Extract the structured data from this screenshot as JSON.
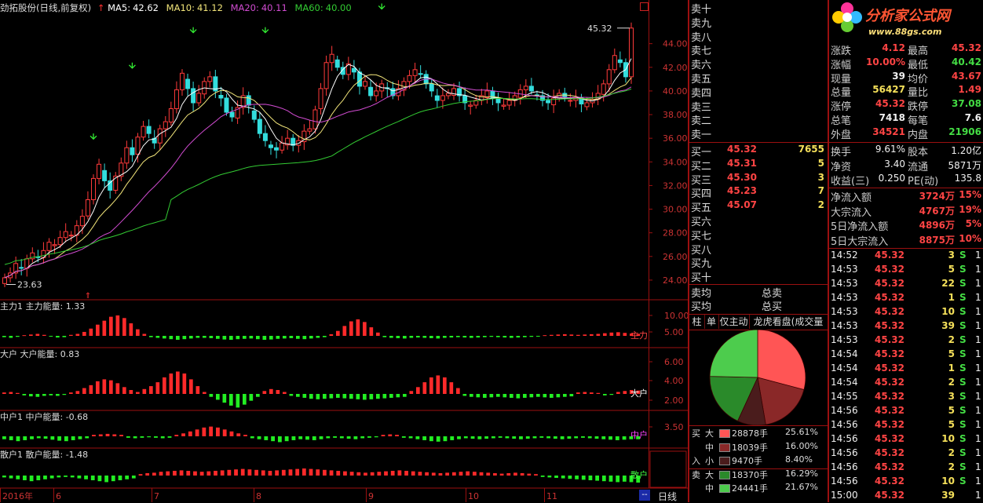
{
  "chart_header": {
    "stock_name": "劲拓股份(日线,前复权)",
    "ma5_label": "MA5:",
    "ma5": "42.62",
    "ma10_label": "MA10:",
    "ma10": "41.12",
    "ma20_label": "MA20:",
    "ma20": "40.11",
    "ma60_label": "MA60:",
    "ma60": "40.00"
  },
  "colors": {
    "up": "#ff3a3a",
    "down": "#33dddd",
    "ma5": "#ffffff",
    "ma10": "#f2e57a",
    "ma20": "#d24cd2",
    "ma60": "#33cc33",
    "frame": "#9b1010",
    "bar_up": "#ff2a2a",
    "bar_down": "#22ee22"
  },
  "chart_data": [
    {
      "type": "candlestick",
      "title": "劲拓股份(日线,前复权)",
      "y_ticks": [
        "44.00",
        "42.00",
        "40.00",
        "38.00",
        "36.00",
        "34.00",
        "32.00",
        "30.00",
        "28.00",
        "26.00",
        "24.00"
      ],
      "ylim": [
        23.0,
        46.5
      ],
      "annotations": {
        "high": "45.32",
        "low": "23.63"
      },
      "x_ticks": [
        "2016年",
        "6",
        "7",
        "8",
        "9",
        "10",
        "11"
      ],
      "series": [
        {
          "name": "MA5",
          "value": "42.62"
        },
        {
          "name": "MA10",
          "value": "41.12"
        },
        {
          "name": "MA20",
          "value": "40.11"
        },
        {
          "name": "MA60",
          "value": "40.00"
        }
      ],
      "close": [
        24.2,
        24.6,
        25.4,
        25.0,
        25.8,
        26.3,
        25.9,
        26.5,
        27.2,
        27.0,
        27.6,
        28.1,
        27.8,
        28.6,
        29.4,
        30.8,
        32.6,
        33.8,
        32.4,
        31.6,
        32.8,
        33.9,
        35.2,
        34.6,
        36.1,
        37.0,
        36.4,
        35.6,
        36.8,
        37.4,
        38.5,
        40.1,
        41.5,
        40.2,
        39.0,
        39.8,
        40.8,
        41.2,
        40.0,
        39.4,
        38.2,
        37.8,
        38.6,
        39.6,
        38.8,
        37.6,
        36.4,
        35.8,
        35.2,
        35.0,
        35.6,
        36.0,
        35.4,
        35.8,
        36.6,
        36.8,
        38.4,
        40.2,
        42.4,
        43.1,
        42.0,
        41.4,
        42.3,
        41.6,
        40.4,
        40.8,
        39.6,
        40.0,
        40.6,
        40.2,
        39.6,
        40.2,
        40.8,
        41.3,
        41.8,
        41.4,
        40.6,
        40.0,
        39.2,
        39.6,
        39.8,
        40.2,
        39.6,
        39.0,
        38.8,
        39.2,
        39.6,
        40.0,
        39.4,
        39.0,
        38.8,
        39.2,
        39.6,
        40.1,
        40.4,
        40.0,
        39.6,
        39.2,
        39.0,
        39.4,
        39.8,
        39.5,
        39.2,
        39.4,
        38.9,
        39.0,
        39.3,
        39.8,
        40.6,
        41.8,
        43.0,
        42.4,
        41.2,
        45.32
      ]
    },
    {
      "type": "bar",
      "title": "主力1",
      "label": "主力能量",
      "value": "1.33",
      "y_ticks": [
        "10.00",
        "5.00"
      ],
      "tag": "主力",
      "values": [
        -0.4,
        -0.6,
        -0.3,
        0.2,
        0.4,
        0.6,
        0.3,
        -0.2,
        -0.5,
        -0.4,
        0.3,
        0.6,
        1.2,
        2.2,
        3.4,
        4.6,
        5.8,
        6.2,
        5.4,
        3.8,
        2.0,
        0.6,
        -0.4,
        -0.6,
        -0.8,
        -1.0,
        -1.2,
        -1.0,
        -0.8,
        -0.6,
        -0.6,
        -0.7,
        -0.9,
        -1.1,
        -1.2,
        -1.0,
        -0.9,
        -0.8,
        -1.0,
        -1.2,
        -1.1,
        -0.9,
        -0.8,
        -0.7,
        -0.9,
        -1.0,
        -0.8,
        -0.6,
        -0.4,
        0.5,
        1.5,
        3.0,
        4.4,
        5.0,
        4.2,
        2.6,
        1.0,
        -0.4,
        -0.6,
        -0.7,
        -0.8,
        -0.6,
        -0.5,
        -0.6,
        -0.7,
        -0.8,
        -0.6,
        -0.5,
        -0.4,
        -0.5,
        -0.6,
        -0.5,
        -0.4,
        -0.3,
        -0.4,
        -0.5,
        -0.6,
        -0.5,
        -0.4,
        -0.3,
        -0.2,
        0.2,
        0.3,
        0.4,
        0.5,
        0.4,
        0.3,
        0.4,
        0.5,
        0.6,
        0.8,
        1.0,
        1.1,
        0.9,
        0.7,
        0.6
      ]
    },
    {
      "type": "bar",
      "title": "大户",
      "label": "大户能量",
      "value": "0.83",
      "y_ticks": [
        "6.00",
        "4.00",
        "2.00"
      ],
      "tag": "大户",
      "values": [
        0.3,
        0.4,
        0.2,
        -0.3,
        -0.5,
        -0.6,
        -0.4,
        -0.3,
        -0.4,
        -0.2,
        0.3,
        0.6,
        1.2,
        1.8,
        2.6,
        3.0,
        2.8,
        2.2,
        1.4,
        0.8,
        0.4,
        1.0,
        1.6,
        2.4,
        3.4,
        4.2,
        4.6,
        4.2,
        3.0,
        1.6,
        0.4,
        -0.6,
        -1.2,
        -1.8,
        -2.4,
        -2.8,
        -2.2,
        -1.4,
        -0.6,
        0.6,
        1.0,
        0.8,
        0.4,
        -0.4,
        -0.6,
        -0.8,
        -1.0,
        -1.1,
        -1.0,
        -0.9,
        -0.8,
        -0.9,
        -1.0,
        -1.1,
        -1.2,
        -1.1,
        -1.0,
        -0.9,
        -0.8,
        -0.7,
        -0.6,
        0.6,
        1.4,
        2.4,
        3.4,
        3.8,
        3.4,
        2.4,
        1.2,
        -0.4,
        -0.6,
        -0.7,
        -0.8,
        -0.7,
        -0.6,
        -0.7,
        -0.8,
        -0.9,
        -0.8,
        -0.7,
        -0.6,
        -0.7,
        -0.8,
        -0.7,
        -0.6,
        -0.5,
        0.3,
        0.4,
        0.3,
        0.2,
        -0.3,
        -0.2,
        0.4,
        0.6,
        0.8,
        0.7
      ]
    },
    {
      "type": "bar",
      "title": "中户1",
      "label": "中户能量",
      "value": "-0.68",
      "y_ticks": [
        "3.50"
      ],
      "tag": "中户",
      "values": [
        -0.6,
        -0.8,
        -1.0,
        -0.8,
        -0.6,
        -0.4,
        -0.5,
        -0.7,
        -0.9,
        -1.0,
        -0.8,
        -0.6,
        -0.4,
        0.3,
        0.4,
        0.5,
        0.4,
        0.3,
        -0.3,
        -0.4,
        -0.3,
        -0.2,
        -0.3,
        -0.4,
        -0.3,
        0.3,
        0.6,
        1.0,
        1.4,
        1.8,
        2.0,
        1.8,
        1.4,
        1.0,
        0.6,
        0.3,
        -0.4,
        -0.6,
        -0.8,
        -1.0,
        -1.2,
        -1.0,
        -0.8,
        -0.6,
        -0.7,
        -0.8,
        -0.6,
        -0.4,
        -0.3,
        -0.4,
        -0.5,
        -0.6,
        -0.4,
        -0.3,
        -0.2,
        0.3,
        0.4,
        0.3,
        -0.3,
        -0.4,
        -0.6,
        -0.8,
        -1.0,
        -1.1,
        -1.0,
        -0.8,
        -0.6,
        -0.4,
        -0.5,
        -0.6,
        -0.5,
        -0.4,
        -0.3,
        -0.4,
        -0.5,
        -0.6,
        -0.5,
        -0.4,
        -0.3,
        -0.4,
        -0.5,
        -0.6,
        -0.5,
        -0.4,
        -0.3,
        -0.4,
        -0.5,
        -0.6,
        -0.7,
        -0.8,
        -0.7,
        -0.6,
        -0.6
      ]
    },
    {
      "type": "bar",
      "title": "散户1",
      "label": "散户能量",
      "value": "-1.48",
      "y_ticks": [],
      "tag": "散户",
      "values": [
        -0.4,
        -0.6,
        -0.8,
        -1.0,
        -1.2,
        -1.0,
        -0.8,
        -0.6,
        -0.4,
        -0.3,
        -0.4,
        -0.6,
        -0.8,
        -1.0,
        -1.2,
        -1.4,
        -1.2,
        -1.0,
        -0.8,
        -0.6,
        0.3,
        0.5,
        0.6,
        0.8,
        0.9,
        1.0,
        1.1,
        1.0,
        0.9,
        0.8,
        0.9,
        1.0,
        1.1,
        1.2,
        1.3,
        1.4,
        1.3,
        1.2,
        1.1,
        1.0,
        1.1,
        1.2,
        1.3,
        1.4,
        1.5,
        1.4,
        1.3,
        1.2,
        1.1,
        1.0,
        0.9,
        0.8,
        0.7,
        0.6,
        0.7,
        0.8,
        0.9,
        1.0,
        1.1,
        1.0,
        0.9,
        0.8,
        0.7,
        0.6,
        0.5,
        0.6,
        0.7,
        0.8,
        0.9,
        0.8,
        0.7,
        0.6,
        0.5,
        0.4,
        0.5,
        0.6,
        0.5,
        0.4,
        0.3,
        -0.3,
        -0.4,
        -0.5,
        -0.6,
        -0.7,
        -0.8,
        -0.9,
        -1.0,
        -1.1,
        -1.2,
        -1.3,
        -1.4,
        -1.3,
        -1.4,
        -1.5
      ]
    },
    {
      "type": "pie",
      "title": "龙虎看盘",
      "categories": [
        "买大",
        "买中",
        "买小",
        "卖大",
        "卖中"
      ],
      "values": [
        25.61,
        16.0,
        8.4,
        16.29,
        21.67
      ],
      "colors": [
        "#ff5555",
        "#8a2828",
        "#4a1c1c",
        "#2a8a2a",
        "#4dcc4d"
      ]
    }
  ],
  "sell_orders": [
    "卖十",
    "卖九",
    "卖八",
    "卖七",
    "卖六",
    "卖五",
    "卖四",
    "卖三",
    "卖二",
    "卖一"
  ],
  "buy_orders": [
    {
      "label": "买一",
      "price": "45.32",
      "vol": "7655"
    },
    {
      "label": "买二",
      "price": "45.31",
      "vol": "5"
    },
    {
      "label": "买三",
      "price": "45.30",
      "vol": "3"
    },
    {
      "label": "买四",
      "price": "45.23",
      "vol": "7"
    },
    {
      "label": "买五",
      "price": "45.07",
      "vol": "2"
    },
    {
      "label": "买六",
      "price": "",
      "vol": ""
    },
    {
      "label": "买七",
      "price": "",
      "vol": ""
    },
    {
      "label": "买八",
      "price": "",
      "vol": ""
    },
    {
      "label": "买九",
      "price": "",
      "vol": ""
    },
    {
      "label": "买十",
      "price": "",
      "vol": ""
    }
  ],
  "avg": {
    "sell_avg": "卖均",
    "sell_total": "总卖",
    "buy_avg": "买均",
    "buy_total": "总买"
  },
  "tabs": [
    "柱",
    "单",
    "仅主动",
    "龙虎看盘(成交量板"
  ],
  "legend": [
    {
      "side": "买",
      "size": "大",
      "amount": "28878手",
      "pct": "25.61%",
      "color": "#ff5555"
    },
    {
      "side": "",
      "size": "中",
      "amount": "18039手",
      "pct": "16.00%",
      "color": "#8a2828"
    },
    {
      "side": "入",
      "size": "小",
      "amount": "9470手",
      "pct": "8.40%",
      "color": "#4a1c1c"
    },
    {
      "side": "卖",
      "size": "大",
      "amount": "18370手",
      "pct": "16.29%",
      "color": "#2a8a2a"
    },
    {
      "side": "",
      "size": "中",
      "amount": "24441手",
      "pct": "21.67%",
      "color": "#4dcc4d"
    }
  ],
  "brand": {
    "title": "分析家公式网",
    "url": "www.88gs.com"
  },
  "quote": {
    "rows": [
      {
        "l1": "涨跌",
        "v1": "4.12",
        "c1": "red",
        "l2": "最高",
        "v2": "45.32",
        "c2": "red"
      },
      {
        "l1": "涨幅",
        "v1": "10.00%",
        "c1": "red",
        "l2": "最低",
        "v2": "40.42",
        "c2": "grn"
      },
      {
        "l1": "现量",
        "v1": "39",
        "c1": "wht",
        "l2": "均价",
        "v2": "43.67",
        "c2": "red"
      },
      {
        "l1": "总量",
        "v1": "56427",
        "c1": "yel",
        "l2": "量比",
        "v2": "1.49",
        "c2": "red"
      },
      {
        "l1": "涨停",
        "v1": "45.32",
        "c1": "red",
        "l2": "跌停",
        "v2": "37.08",
        "c2": "grn"
      },
      {
        "l1": "总笔",
        "v1": "7418",
        "c1": "wht",
        "l2": "每笔",
        "v2": "7.6",
        "c2": "wht"
      },
      {
        "l1": "外盘",
        "v1": "34521",
        "c1": "red",
        "l2": "内盘",
        "v2": "21906",
        "c2": "grn"
      }
    ],
    "rows2": [
      {
        "l1": "换手",
        "v1": "9.61%",
        "l2": "股本",
        "v2": "1.20亿"
      },
      {
        "l1": "净资",
        "v1": "3.40",
        "l2": "流通",
        "v2": "5871万"
      },
      {
        "l1": "收益(三)",
        "v1": "0.250",
        "l2": "PE(动)",
        "v2": "135.8"
      }
    ],
    "flows": [
      {
        "label": "净流入额",
        "amount": "3724万",
        "pct": "15%"
      },
      {
        "label": "大宗流入",
        "amount": "4767万",
        "pct": "19%"
      },
      {
        "label": "5日净流入额",
        "amount": "4896万",
        "pct": "5%"
      },
      {
        "label": "5日大宗流入",
        "amount": "8875万",
        "pct": "10%"
      }
    ]
  },
  "ticks": [
    {
      "t": "14:52",
      "p": "45.32",
      "v": "3",
      "s": "S",
      "n": "1"
    },
    {
      "t": "14:53",
      "p": "45.32",
      "v": "5",
      "s": "S",
      "n": "1"
    },
    {
      "t": "14:53",
      "p": "45.32",
      "v": "22",
      "s": "S",
      "n": "1"
    },
    {
      "t": "14:53",
      "p": "45.32",
      "v": "1",
      "s": "S",
      "n": "1"
    },
    {
      "t": "14:53",
      "p": "45.32",
      "v": "10",
      "s": "S",
      "n": "1"
    },
    {
      "t": "14:53",
      "p": "45.32",
      "v": "39",
      "s": "S",
      "n": "1"
    },
    {
      "t": "14:53",
      "p": "45.32",
      "v": "2",
      "s": "S",
      "n": "1"
    },
    {
      "t": "14:54",
      "p": "45.32",
      "v": "5",
      "s": "S",
      "n": "1"
    },
    {
      "t": "14:54",
      "p": "45.32",
      "v": "1",
      "s": "S",
      "n": "1"
    },
    {
      "t": "14:54",
      "p": "45.32",
      "v": "2",
      "s": "S",
      "n": "1"
    },
    {
      "t": "14:55",
      "p": "45.32",
      "v": "3",
      "s": "S",
      "n": "1"
    },
    {
      "t": "14:56",
      "p": "45.32",
      "v": "5",
      "s": "S",
      "n": "1"
    },
    {
      "t": "14:56",
      "p": "45.32",
      "v": "5",
      "s": "S",
      "n": "1"
    },
    {
      "t": "14:56",
      "p": "45.32",
      "v": "10",
      "s": "S",
      "n": "1"
    },
    {
      "t": "14:56",
      "p": "45.32",
      "v": "2",
      "s": "S",
      "n": "1"
    },
    {
      "t": "14:56",
      "p": "45.32",
      "v": "2",
      "s": "S",
      "n": "1"
    },
    {
      "t": "14:56",
      "p": "45.32",
      "v": "10",
      "s": "S",
      "n": "1"
    },
    {
      "t": "15:00",
      "p": "45.32",
      "v": "39",
      "s": "",
      "n": "1"
    }
  ],
  "bottom": {
    "period": "日线",
    "scroll": "--"
  }
}
